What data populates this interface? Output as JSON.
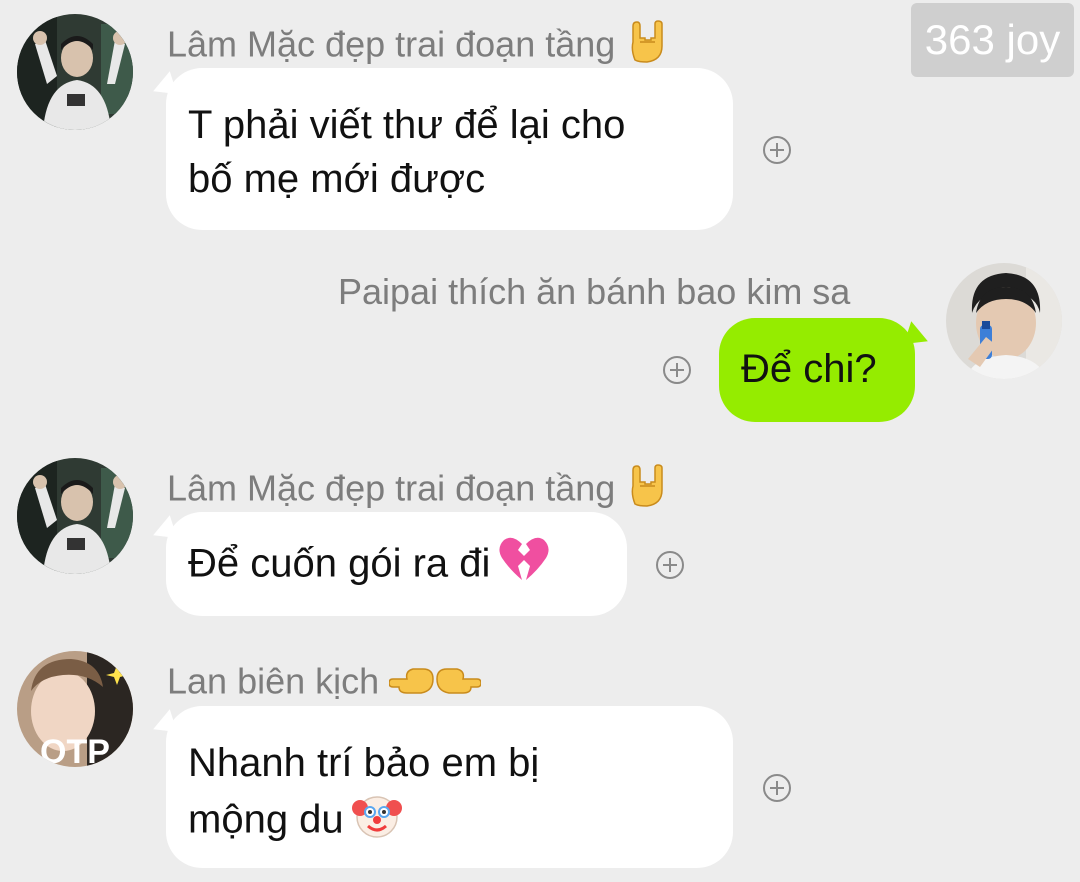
{
  "watermark": "363 joy",
  "messages": [
    {
      "sender": "Lâm Mặc đẹp trai đoạn tầng",
      "sender_emoji": "rock-on-hand-icon",
      "lines": [
        "T phải viết thư để lại cho",
        "bố mẹ mới được"
      ],
      "direction": "incoming"
    },
    {
      "sender": "Paipai thích ăn bánh bao kim sa",
      "lines": [
        "Để chi?"
      ],
      "direction": "outgoing"
    },
    {
      "sender": "Lâm Mặc đẹp trai đoạn tầng",
      "sender_emoji": "rock-on-hand-icon",
      "lines": [
        "Để cuốn gói ra đi"
      ],
      "text_emoji": "broken-heart-icon",
      "direction": "incoming"
    },
    {
      "sender": "Lan biên kịch",
      "sender_emoji": "pointing-hands-icon",
      "lines": [
        "Nhanh trí bảo em bị",
        "mộng du"
      ],
      "text_emoji": "clown-face-icon",
      "direction": "incoming"
    }
  ],
  "avatar_text": "OTP",
  "colors": {
    "background": "#ededed",
    "incoming_bubble": "#ffffff",
    "outgoing_bubble": "#95ec00",
    "sender_name": "#7d7d7d"
  }
}
